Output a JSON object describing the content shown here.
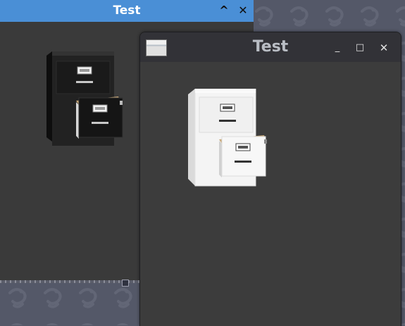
{
  "desktop": {
    "background_color": "#545868",
    "wallpaper_icon": "ghost-mascot-icon"
  },
  "back_window": {
    "title": "Test",
    "titlebar_color": "#4a8fd6",
    "buttons": {
      "collapse": "^",
      "close": "✕"
    },
    "image": "black-filing-cabinet-icon"
  },
  "front_window": {
    "title": "Test",
    "app_icon": "window-app-icon",
    "buttons": {
      "minimize": "_",
      "maximize": "□",
      "close": "✕"
    },
    "image": "white-filing-cabinet-icon"
  }
}
